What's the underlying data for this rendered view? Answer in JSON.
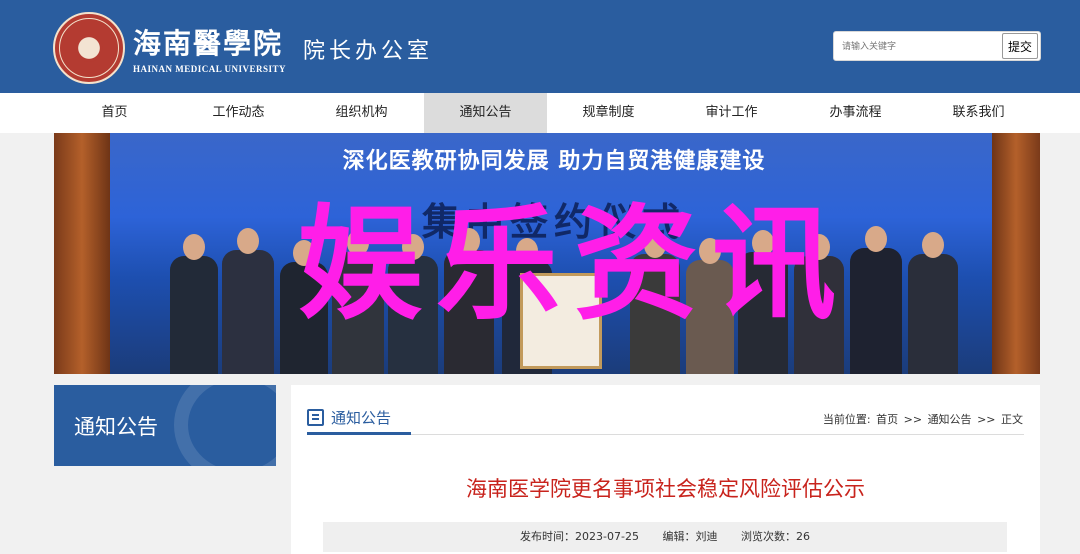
{
  "header": {
    "school_name_cn": "海南醫學院",
    "school_name_en": "HAINAN MEDICAL UNIVERSITY",
    "department": "院长办公室",
    "search": {
      "placeholder": "请输入关键字",
      "button_label": "提交"
    },
    "brand_color": "#2a5d9f"
  },
  "nav": {
    "items": [
      {
        "label": "首页"
      },
      {
        "label": "工作动态"
      },
      {
        "label": "组织机构"
      },
      {
        "label": "通知公告",
        "active": true
      },
      {
        "label": "规章制度"
      },
      {
        "label": "审计工作"
      },
      {
        "label": "办事流程"
      },
      {
        "label": "联系我们"
      }
    ]
  },
  "banner": {
    "title": "深化医教研协同发展  助力自贸港健康建设",
    "subtitle": "集中签约仪式",
    "overlay_text": "娱乐资讯",
    "overlay_color": "#ff1ee8"
  },
  "sidebar": {
    "title": "通知公告"
  },
  "content": {
    "section_title": "通知公告",
    "breadcrumb": {
      "prefix": "当前位置:",
      "items": [
        "首页",
        "通知公告",
        "正文"
      ],
      "separator": ">>"
    },
    "article": {
      "title": "海南医学院更名事项社会稳定风险评估公示",
      "publish_label": "发布时间：2023-07-25",
      "editor_label": "编辑：刘迪",
      "views_label": "浏览次数：26"
    }
  }
}
